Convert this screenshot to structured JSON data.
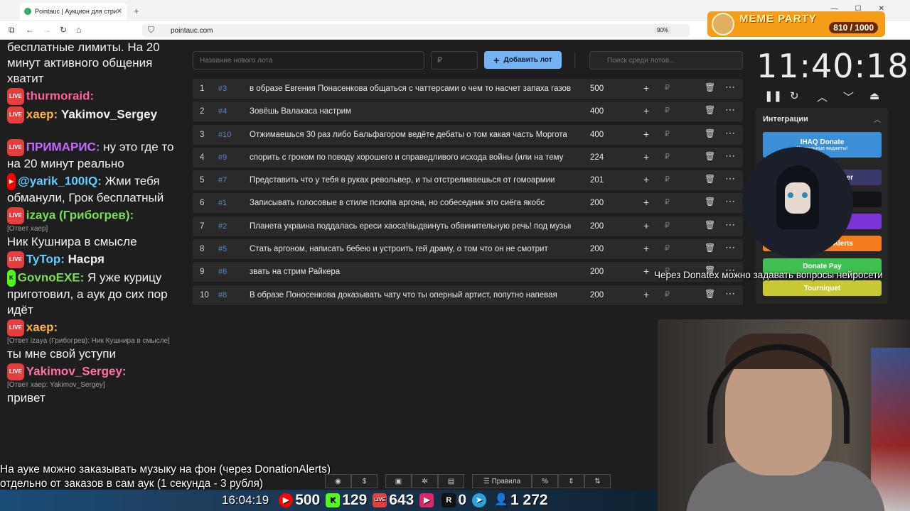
{
  "browser": {
    "tab_title": "Pointauc | Аукцион для стримера",
    "url": "pointauc.com",
    "zoom": "90%"
  },
  "meme_party": {
    "title": "MEME PARTY",
    "score": "810 / 1000"
  },
  "chat": [
    {
      "text": "бесплатные лимиты. На 20 минут активного общения хватит"
    },
    {
      "nick": "thurmoraid:",
      "color": "#ff5fa0",
      "badges": [
        "LIVE"
      ],
      "text": ""
    },
    {
      "nick": "хаер:",
      "color": "#ffb04a",
      "badges": [
        "LIVE"
      ],
      "text": "Yakimov_Sergey"
    },
    {
      "nick": "ПРИМАРИС:",
      "color": "#c56cff",
      "badges": [
        "LIVE"
      ],
      "text": "ну это где то на 20 минут реально"
    },
    {
      "nick": "@yarik_100IQ:",
      "color": "#5fd0ff",
      "badges": [
        "YT"
      ],
      "text": "Жми тебя обманули, Грок бесплатный"
    },
    {
      "nick": "izaya (Грибогрев):",
      "color": "#7bdc5a",
      "badges": [
        "LIVE"
      ],
      "meta": "[Ответ хаер]",
      "text": "Ник Кушнира в смысле"
    },
    {
      "nick": "TyTop:",
      "color": "#5fd0ff",
      "badges": [
        "LIVE"
      ],
      "text": "Насря"
    },
    {
      "nick": "GovnoEXE:",
      "color": "#7bdc5a",
      "badges": [
        "K"
      ],
      "text": "Я уже курицу приготовил, а аук до сих пор идёт"
    },
    {
      "nick": "хаер:",
      "color": "#ffb04a",
      "badges": [
        "LIVE"
      ],
      "meta": "[Ответ izaya (Грибогрев): Ник Кушнира в смысле]",
      "text": "ты мне свой уступи"
    },
    {
      "nick": "Yakimov_Sergey:",
      "color": "#ff6fa8",
      "badges": [
        "LIVE"
      ],
      "meta": "[Ответ хаер: Yakimov_Sergey]",
      "text": "привет"
    }
  ],
  "controls": {
    "new_lot_placeholder": "Название нового лота",
    "price_placeholder": "₽",
    "add_button": "Добавить лот",
    "search_placeholder": "Поиск среди лотов..."
  },
  "lots": [
    {
      "n": "1",
      "id": "#3",
      "name": "в образе Евгения Понасенкова общаться с чаттерсами о чем то насчет запаха газов и выясн",
      "amount": "500"
    },
    {
      "n": "2",
      "id": "#4",
      "name": "Зовёшь Валакаса настрим",
      "amount": "400"
    },
    {
      "n": "3",
      "id": "#10",
      "name": "Отжимаешься 30 раз либо Бальфагором ведёте дебаты о том какая часть Моргота",
      "amount": "400"
    },
    {
      "n": "4",
      "id": "#9",
      "name": "спорить с гроком по поводу хорошего и справедливого исхода войны (или на тему",
      "amount": "224"
    },
    {
      "n": "5",
      "id": "#7",
      "name": "Представить что у тебя в руках револьвер, и ты отстреливаешься от гомоармии",
      "amount": "201"
    },
    {
      "n": "6",
      "id": "#1",
      "name": "Записывать голосовые в стиле псиопа аргона, но собеседник это сиёга якобс",
      "amount": "200"
    },
    {
      "n": "7",
      "id": "#2",
      "name": "Планета украина поддалась ереси хаоса!выдвинуть обвинительную речь! под музыку",
      "amount": "200"
    },
    {
      "n": "8",
      "id": "#5",
      "name": "Стать аргоном, написать бебею и устроить гей драму, о том что он не смотрит",
      "amount": "200"
    },
    {
      "n": "9",
      "id": "#6",
      "name": "звать на стрим Райкера",
      "amount": "200"
    },
    {
      "n": "10",
      "id": "#8",
      "name": "В образе Поносенкова доказывать чату что ты оперный артист, попутно напевая",
      "amount": "200"
    }
  ],
  "timer": {
    "value": "11:40:18"
  },
  "integrations": {
    "title": "Интеграции",
    "items": [
      {
        "label": "IHAQ Donate",
        "sub": "Уникальные виджеты!",
        "color": "#3a8fd6"
      },
      {
        "label": "er",
        "color": "#3a3a6a"
      },
      {
        "label": "",
        "color": "#141418"
      },
      {
        "label": "",
        "color": "#7c34d8"
      },
      {
        "label": "Alerts",
        "color": "#f57c1f"
      },
      {
        "label": "Donate Pay",
        "color": "#3fbf4f"
      },
      {
        "label": "Tourniquet",
        "color": "#c8c832"
      }
    ]
  },
  "donatex_text": "Через Donatex можно задавать вопросы нейросети",
  "bottom_text": {
    "line1": "На ауке можно заказывать музыку на фон (через DonationAlerts)",
    "line2": "отдельно от заказов в сам аук (1 секунда - 3 рубля)"
  },
  "toolbar": {
    "rules": "Правила",
    "percent": "%"
  },
  "stats": {
    "clock": "16:04:19",
    "youtube": "500",
    "kick": "129",
    "live": "643",
    "rutube": "0",
    "viewers": "1 272"
  }
}
